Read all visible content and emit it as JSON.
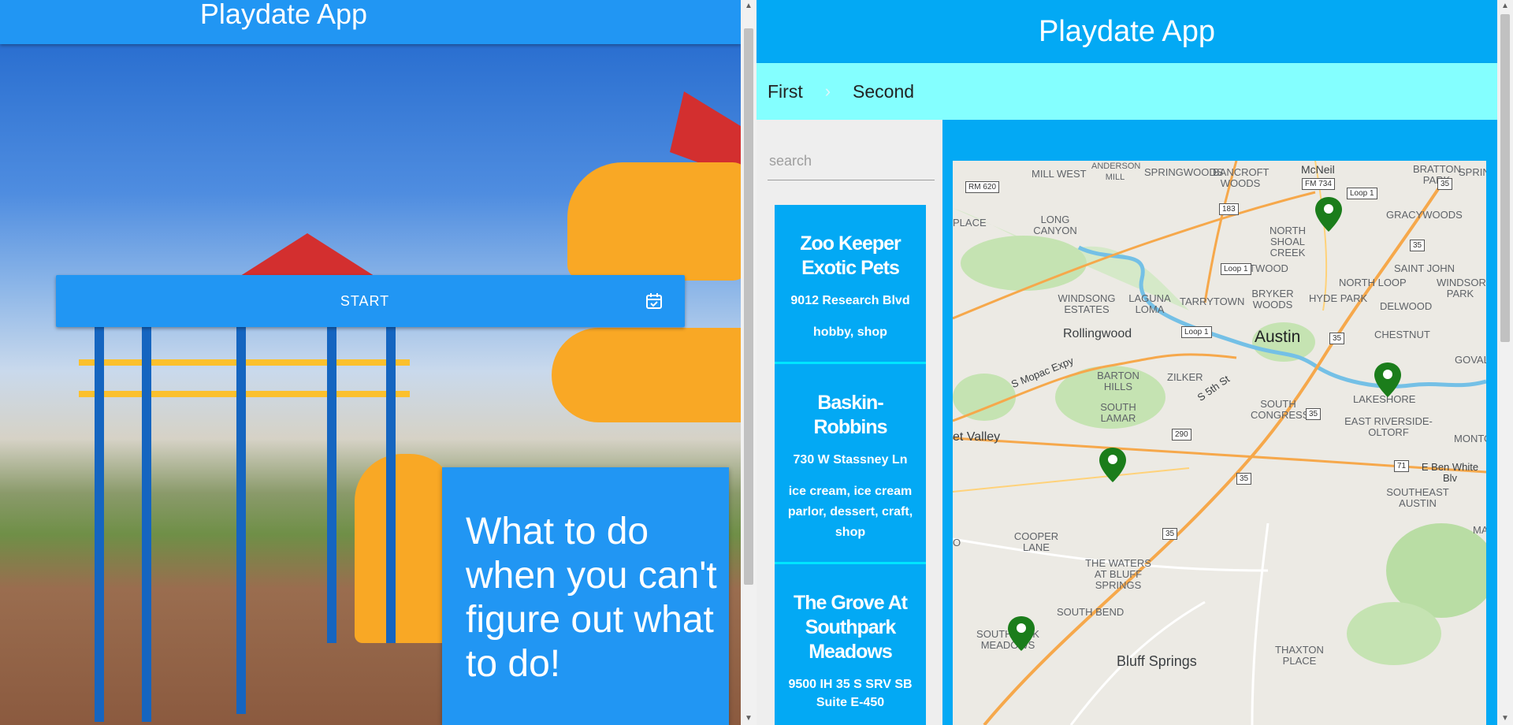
{
  "left": {
    "header_title": "Playdate App",
    "start_label": "START",
    "promo_text": "What to do when you can't figure out what to do!"
  },
  "right": {
    "header_title": "Playdate App",
    "steps": [
      {
        "label": "First"
      },
      {
        "label": "Second"
      }
    ],
    "search": {
      "placeholder": "search",
      "value": ""
    },
    "places": [
      {
        "name": "Zoo Keeper Exotic Pets",
        "address": "9012 Research Blvd",
        "tags": "hobby, shop"
      },
      {
        "name": "Baskin-Robbins",
        "address": "730 W Stassney Ln",
        "tags": "ice cream, ice cream parlor, dessert, craft, shop"
      },
      {
        "name": "The Grove At Southpark Meadows",
        "address": "9500 IH 35 S SRV SB Suite E-450",
        "tags": ""
      }
    ],
    "map": {
      "labels": {
        "mill_west": "MILL WEST",
        "anderson_mill": "ANDERSON MILL",
        "springwoods": "SPRINGWOODS",
        "bancroft_woods": "BANCROFT WOODS",
        "mcneil": "McNeil",
        "bratton_park": "BRATTON PARK",
        "spring": "SPRIN",
        "long_canyon": "LONG CANYON",
        "x_place": "PLACE",
        "north_shoal_creek": "NORTH SHOAL CREEK",
        "gracywoods": "GRACYWOODS",
        "brentwood": "BRENTWOOD",
        "saint_johns": "SAINT JOHN",
        "windsor_park": "WINDSOR PARK",
        "north_loop": "NORTH LOOP",
        "windsong_estates": "WINDSONG ESTATES",
        "laguna_loma": "LAGUNA LOMA",
        "tarrytown": "TARRYTOWN",
        "bryker_woods": "BRYKER WOODS",
        "hyde_park": "HYDE PARK",
        "delwood": "DELWOOD",
        "chestnut": "CHESTNUT",
        "rollingwood": "Rollingwood",
        "austin": "Austin",
        "govalle": "GOVALLE",
        "mopac": "S Mopac Expy",
        "barton_hills": "BARTON HILLS",
        "zilker": "ZILKER",
        "s_fifth_st": "S 5th St",
        "lakeshore": "LAKESHORE",
        "south_lamar": "SOUTH LAMAR",
        "south_congress": "SOUTH CONGRESS",
        "east_riverside": "EAST RIVERSIDE-OLTORF",
        "montopolis": "MONTO",
        "west_valley": "et Valley",
        "ben_white": "E Ben White Blv",
        "southeast_austin": "SOUTHEAST AUSTIN",
        "cooper_lane": "COOPER LANE",
        "waters_bluff": "THE WATERS AT BLUFF SPRINGS",
        "ma": "MA",
        "south_bend": "SOUTH BEND",
        "southpark_meadows": "SOUTHPARK MEADOWS",
        "bluff_springs": "Bluff Springs",
        "thaxton_place": "THAXTON PLACE",
        "o_edge": "O"
      },
      "shields": {
        "rm620": "RM 620",
        "fm734": "FM 734",
        "loop1_a": "Loop 1",
        "loop1_b": "Loop 1",
        "loop1_c": "Loop 1",
        "us183": "183",
        "i35_a": "35",
        "i35_b": "35",
        "i35_c": "35",
        "i35_d": "35",
        "i35_e": "35",
        "i35_f": "35",
        "us290": "290",
        "sh71": "71"
      },
      "marker_color": "#1b7d1b"
    },
    "colors": {
      "primary": "#2196f3",
      "header": "#03a9f4",
      "stepper": "#84ffff"
    }
  }
}
